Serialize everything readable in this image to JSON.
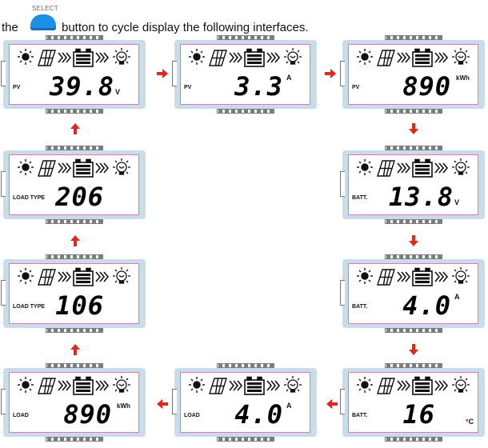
{
  "instruction": {
    "prefix": "the",
    "button_label": "SELECT",
    "suffix": "button to cycle display the following interfaces."
  },
  "colors": {
    "accent_button": "#1e8fe6",
    "arrow": "#e0281e",
    "lcd_border": "#e46fc6",
    "bezel": "#c9dde8"
  },
  "icons": [
    "sun-icon",
    "solar-panel-icon",
    "flow-chevrons-icon",
    "battery-icon",
    "flow-chevrons-icon",
    "bulb-icon"
  ],
  "screens": [
    {
      "label": "PV",
      "value": "39.8",
      "unit": "V"
    },
    {
      "label": "PV",
      "value": "3.3",
      "unit": "A"
    },
    {
      "label": "PV",
      "value": "890",
      "unit": "kWh"
    },
    {
      "label": "BATT.",
      "value": "13.8",
      "unit": "V"
    },
    {
      "label": "BATT.",
      "value": "4.0",
      "unit": "A"
    },
    {
      "label": "BATT.",
      "value": "16",
      "unit": "°C"
    },
    {
      "label": "LOAD",
      "value": "4.0",
      "unit": "A"
    },
    {
      "label": "LOAD",
      "value": "890",
      "unit": "kWh"
    },
    {
      "label": "LOAD TYPE",
      "value": "106",
      "unit": ""
    },
    {
      "label": "LOAD TYPE",
      "value": "206",
      "unit": ""
    }
  ]
}
